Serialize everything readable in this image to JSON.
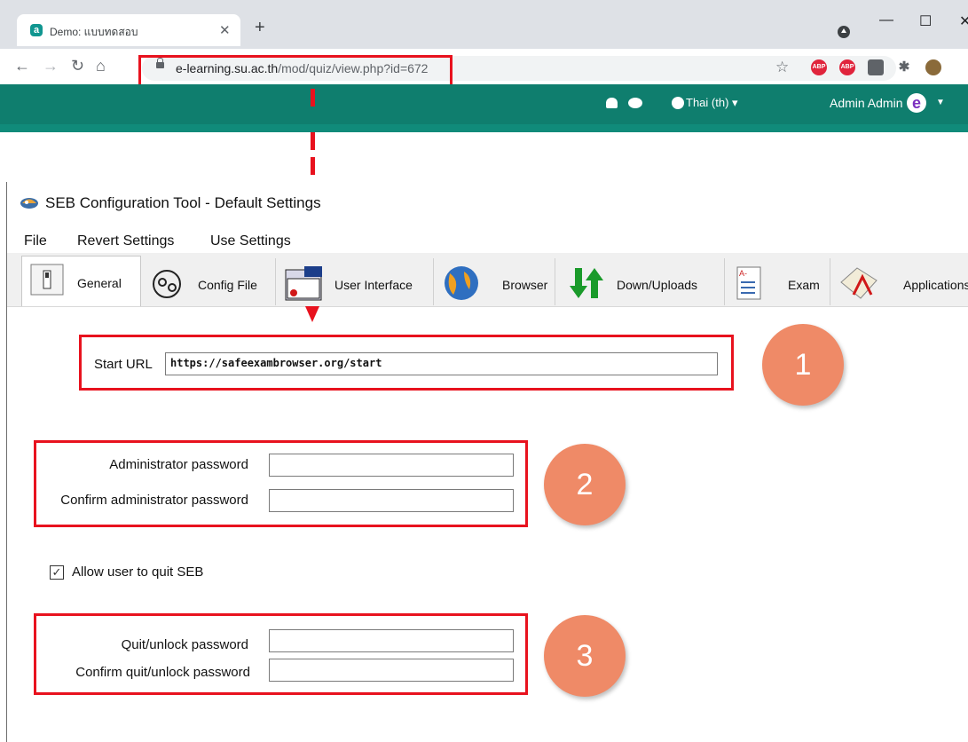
{
  "browser": {
    "tab_title": "Demo: แบบทดสอบ",
    "tab_favicon": "a",
    "url_host": "e-learning.su.ac.th",
    "url_rest": "/mod/quiz/view.php?id=672",
    "extensions": [
      "ABP",
      "ABP",
      "",
      "",
      ""
    ]
  },
  "moodle": {
    "language": "Thai (th) ▾",
    "user_name": "Admin Admin",
    "avatar_letter": "e",
    "accent_color": "#0f7e6e"
  },
  "seb": {
    "title": "SEB Configuration Tool - Default Settings",
    "menu": [
      "File",
      "Revert Settings",
      "Use Settings"
    ],
    "tabs": [
      {
        "label": "General",
        "icon": "switch-icon"
      },
      {
        "label": "Config File",
        "icon": "gears-icon"
      },
      {
        "label": "User Interface",
        "icon": "window-icon"
      },
      {
        "label": "Browser",
        "icon": "globe-icon"
      },
      {
        "label": "Down/Uploads",
        "icon": "arrows-icon"
      },
      {
        "label": "Exam",
        "icon": "checklist-icon"
      },
      {
        "label": "Applications",
        "icon": "app-icon"
      }
    ],
    "start_url_label": "Start URL",
    "start_url_value": "https://safeexambrowser.org/start",
    "admin_password_label": "Administrator password",
    "confirm_admin_password_label": "Confirm administrator password",
    "allow_quit_label": "Allow user to quit SEB",
    "allow_quit_checked": true,
    "quit_password_label": "Quit/unlock password",
    "confirm_quit_password_label": "Confirm quit/unlock password"
  },
  "annotations": {
    "step1": "1",
    "step2": "2",
    "step3": "3",
    "highlight_color": "#e8121e",
    "circle_color": "#ef8a67"
  }
}
